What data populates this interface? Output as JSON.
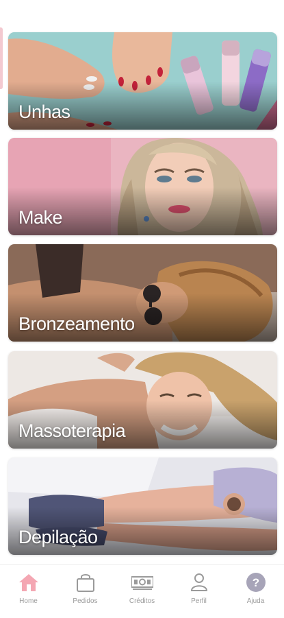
{
  "categories": [
    {
      "label": "Unhas"
    },
    {
      "label": "Make"
    },
    {
      "label": "Bronzeamento"
    },
    {
      "label": "Massoterapia"
    },
    {
      "label": "Depilação"
    }
  ],
  "tabbar": {
    "home": "Home",
    "orders": "Pedidos",
    "credits": "Créditos",
    "profile": "Perfil",
    "help": "Ajuda",
    "help_glyph": "?"
  },
  "colors": {
    "accent_home": "#f4a7b3",
    "icon_gray": "#9a9a9a",
    "help_circle": "#a7a4b8"
  }
}
